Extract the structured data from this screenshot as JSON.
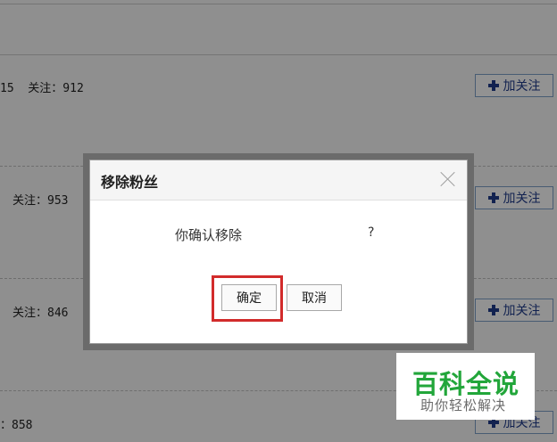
{
  "background": {
    "rows": [
      {
        "follow_text": "15  关注：912",
        "button_label": "加关注"
      },
      {
        "follow_text": "关注：953",
        "button_label": "加关注"
      },
      {
        "follow_text": "关注：846",
        "button_label": "加关注"
      },
      {
        "follow_text": "：858",
        "button_label": "加关注"
      }
    ]
  },
  "dialog": {
    "title": "移除粉丝",
    "message": "你确认移除",
    "question_mark": "?",
    "confirm_label": "确定",
    "cancel_label": "取消"
  },
  "watermark": {
    "title": "百科全说",
    "subtitle": "助你轻松解决"
  },
  "colors": {
    "highlight": "#d22b2b",
    "follow_button_text": "#1f3b8a",
    "watermark_green": "#22a63a"
  }
}
